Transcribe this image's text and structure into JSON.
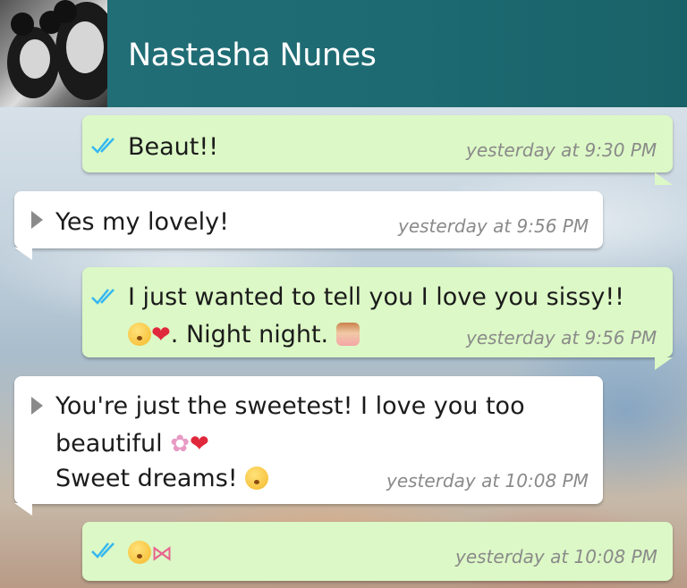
{
  "header": {
    "contact_name": "Nastasha Nunes"
  },
  "messages": [
    {
      "direction": "out",
      "text": "Beaut!!",
      "time": "yesterday at 9:30 PM",
      "read": true
    },
    {
      "direction": "in",
      "text": "Yes my lovely!",
      "time": "yesterday at 9:56 PM"
    },
    {
      "direction": "out",
      "line1": "I just wanted to tell you I love you sissy!!",
      "line2": ". Night night.",
      "time": "yesterday at 9:56 PM",
      "read": true
    },
    {
      "direction": "in",
      "line1": "You're just the sweetest! I love you too",
      "line2": "beautiful",
      "line3": "Sweet dreams!",
      "time": "yesterday at 10:08 PM"
    },
    {
      "direction": "out",
      "time": "yesterday at 10:08 PM",
      "read": true
    }
  ],
  "icons": {
    "read_ticks": "double-check-icon",
    "incoming_marker": "triangle-marker-icon"
  },
  "colors": {
    "header": "#1d6a72",
    "outgoing_bubble": "#dcf8c6",
    "incoming_bubble": "#ffffff",
    "read_ticks": "#34b7f1"
  }
}
